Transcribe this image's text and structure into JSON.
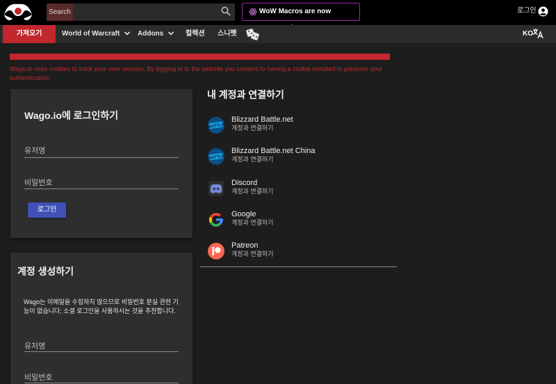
{
  "header": {
    "search_label": "Search",
    "search_value": "",
    "macro_banner": "WoW Macros are now supported!",
    "login": "로그인"
  },
  "nav": {
    "items": [
      {
        "label": "가져오기",
        "active": true
      },
      {
        "label": "World of Warcraft",
        "dropdown": true
      },
      {
        "label": "Addons",
        "dropdown": true
      },
      {
        "label": "컬렉션"
      },
      {
        "label": "스니펫"
      }
    ],
    "lang": "KO"
  },
  "cookie": {
    "text": "Wago.io uses cookies to track your user session. By logging in to the website you consent to having a cookie installed to preserve your authentication."
  },
  "login_card": {
    "title": "Wago.io에 로그인하기",
    "username_placeholder": "유저명",
    "password_placeholder": "비밀번호",
    "button": "로그인"
  },
  "signup_card": {
    "title": "계정 생성하기",
    "description": "Wago는 이메일을 수집하지 않으므로 비밀번호 분실 관련 기능이 없습니다; 소셜 로그인을 사용하시는 것을 추천합니다.",
    "username_placeholder": "유저명",
    "password_placeholder": "비밀번호"
  },
  "connect": {
    "title": "내 계정과 연결하기",
    "providers": [
      {
        "name": "Blizzard Battle.net",
        "action": "계정과 연결하기",
        "icon": "battlenet-icon"
      },
      {
        "name": "Blizzard Battle.net China",
        "action": "계정과 연결하기",
        "icon": "battlenet-icon"
      },
      {
        "name": "Discord",
        "action": "계정과 연결하기",
        "icon": "discord-icon"
      },
      {
        "name": "Google",
        "action": "계정과 연결하기",
        "icon": "google-icon"
      },
      {
        "name": "Patreon",
        "action": "계정과 연결하기",
        "icon": "patreon-icon"
      }
    ]
  },
  "colors": {
    "accent_red": "#c1272d",
    "primary_blue": "#3f51b5",
    "banner_border": "#a02aa8"
  }
}
